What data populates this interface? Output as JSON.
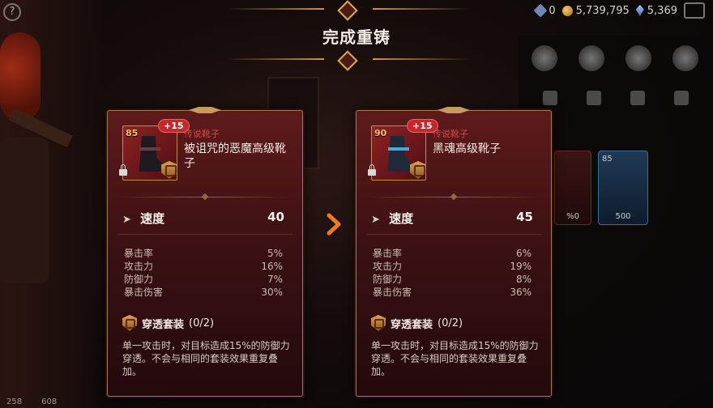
{
  "header": {
    "title": "完成重铸"
  },
  "topbar": {
    "gems": "0",
    "gold": "5,739,795",
    "crystals": "5,369"
  },
  "bottom_left": {
    "count1": "258",
    "count2": "608"
  },
  "right_panel": {
    "card_left_value": "%0",
    "card_right_level": "85",
    "card_right_value": "500"
  },
  "before": {
    "level": "85",
    "enhance": "+15",
    "rarity": "传说靴子",
    "name": "被诅咒的恶魔高级靴子",
    "main_stat": {
      "label": "速度",
      "value": "40"
    },
    "substats": [
      {
        "label": "暴击率",
        "value": "5%"
      },
      {
        "label": "攻击力",
        "value": "16%"
      },
      {
        "label": "防御力",
        "value": "7%"
      },
      {
        "label": "暴击伤害",
        "value": "30%"
      }
    ],
    "set": {
      "name": "穿透套装",
      "count": "(0/2)",
      "desc": "单一攻击时，对目标造成15%的防御力穿透。不会与相同的套装效果重复叠加。"
    }
  },
  "after": {
    "level": "90",
    "enhance": "+15",
    "rarity": "传说靴子",
    "name": "黑魂高级靴子",
    "main_stat": {
      "label": "速度",
      "value": "45"
    },
    "substats": [
      {
        "label": "暴击率",
        "value": "6%"
      },
      {
        "label": "攻击力",
        "value": "19%"
      },
      {
        "label": "防御力",
        "value": "8%"
      },
      {
        "label": "暴击伤害",
        "value": "36%"
      }
    ],
    "set": {
      "name": "穿透套装",
      "count": "(0/2)",
      "desc": "单一攻击时，对目标造成15%的防御力穿透。不会与相同的套装效果重复叠加。"
    }
  },
  "colors": {
    "card_bg": "#3d1113",
    "gold_trim": "#c9974e",
    "arrow": "#f07a1e",
    "rarity": "#d44a4a"
  }
}
